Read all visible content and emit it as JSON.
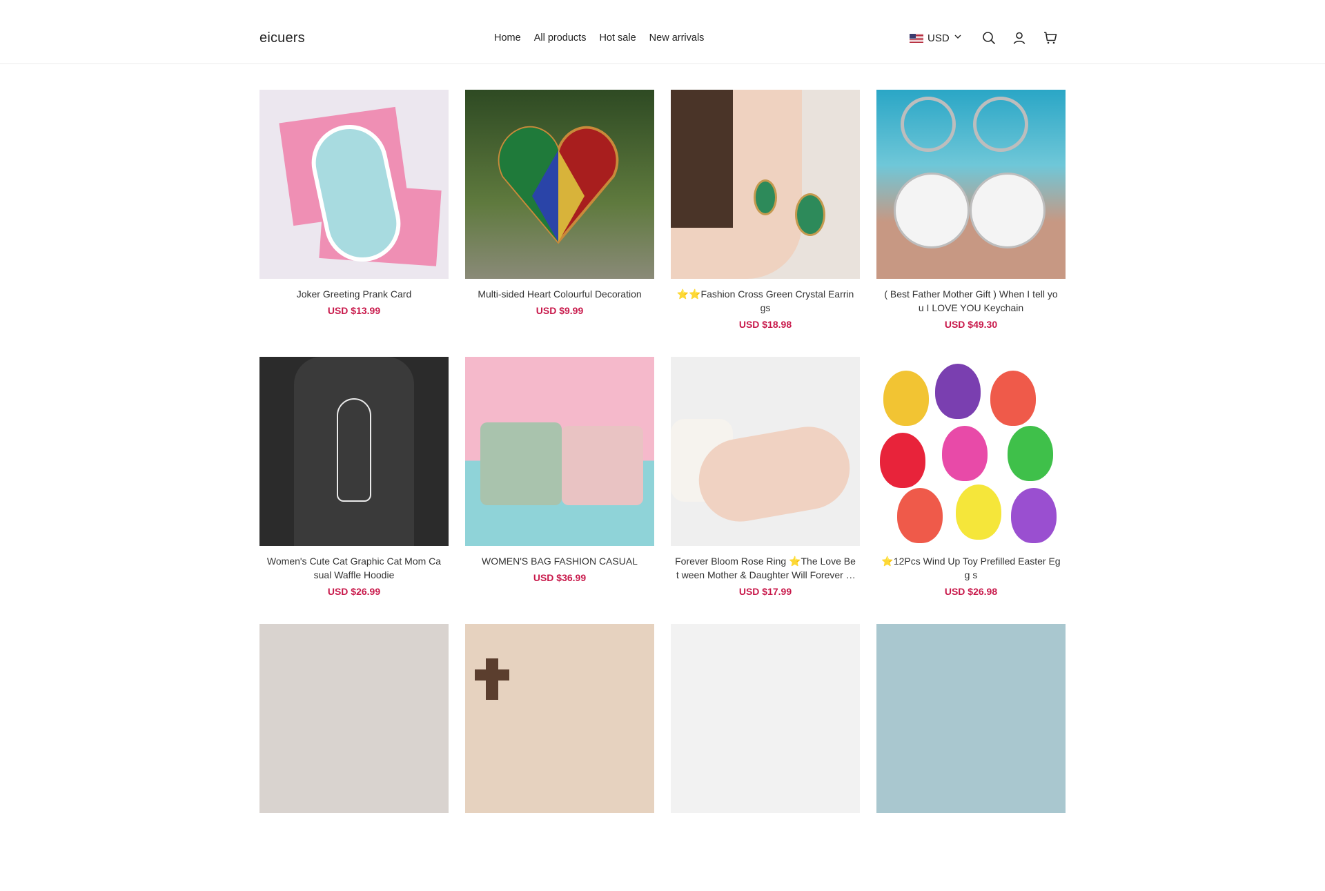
{
  "header": {
    "logo": "eicuers",
    "nav": [
      "Home",
      "All products",
      "Hot sale",
      "New arrivals"
    ],
    "currency": {
      "flag_icon": "us-flag-icon",
      "code": "USD"
    },
    "icons": [
      "search-icon",
      "account-icon",
      "cart-icon"
    ]
  },
  "products": [
    {
      "name": "Joker Greeting Prank Card",
      "price": "USD $13.99"
    },
    {
      "name": "Multi-sided Heart Colourful Decoration",
      "price": "USD $9.99"
    },
    {
      "name": "⭐⭐Fashion Cross Green Crystal Earrings",
      "price": "USD $18.98"
    },
    {
      "name": "( Best Father Mother Gift ) When I tell yo u I LOVE YOU Keychain",
      "price": "USD $49.30"
    },
    {
      "name": "Women's Cute Cat Graphic Cat Mom Ca sual Waffle Hoodie",
      "price": "USD $26.99"
    },
    {
      "name": "WOMEN'S BAG FASHION CASUAL",
      "price": "USD $36.99"
    },
    {
      "name": "Forever Bloom Rose Ring ⭐The Love Bet ween Mother & Daughter Will Forever Bloom",
      "price": "USD $17.99"
    },
    {
      "name": "⭐12Pcs Wind Up Toy Prefilled Easter Egg s",
      "price": "USD $26.98"
    }
  ],
  "colors": {
    "price": "#c8184a",
    "text": "#333333",
    "border": "#ececec"
  }
}
